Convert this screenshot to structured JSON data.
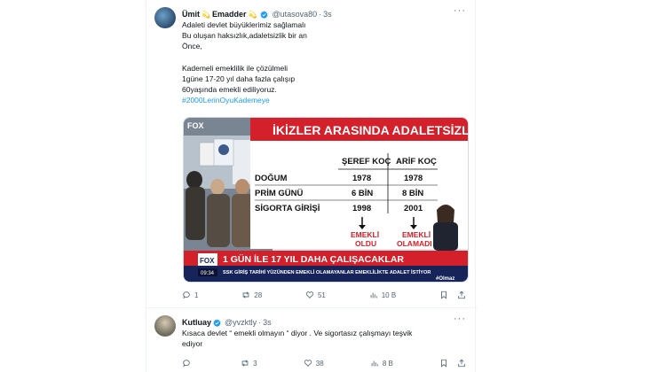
{
  "tweet1": {
    "name": "Ümit",
    "emoji_1": "💫",
    "name_2": "Emadder",
    "emoji_2": "💫",
    "handle": "@utasova80",
    "dot": "·",
    "time": "3s",
    "lines": [
      "Adaleti devlet büyüklerimiz sağlamalı",
      "Bu oluşan haksızlık,adaletsizlik bir an",
      "Önce,",
      "",
      "Kademeli emeklilik ile çözülmeli",
      "1güne 17-20 yıl daha fazla çalışıp",
      "60yaşında emekli ediliyoruz."
    ],
    "hashtag": "#2000LerinOyuKademeye",
    "media": {
      "channel_logo": "FOX",
      "headline": "İKİZLER ARASINDA ADALETSİZLİK",
      "col_1": "ŞEREF KOÇ",
      "col_2": "ARİF KOÇ",
      "rows": [
        {
          "label": "DOĞUM",
          "v1": "1978",
          "v2": "1978"
        },
        {
          "label": "PRİM GÜNÜ",
          "v1": "6 BİN",
          "v2": "8 BİN"
        },
        {
          "label": "SİGORTA GİRİŞİ",
          "v1": "1998",
          "v2": "2001"
        }
      ],
      "result_1a": "EMEKLİ",
      "result_1b": "OLDU",
      "result_2a": "EMEKLİ",
      "result_2b": "OLAMADI",
      "banner": "1 GÜN İLE 17 YIL DAHA ÇALIŞACAKLAR",
      "subbanner": "SSK GİRİŞ TARİHİ YÜZÜNDEN EMEKLİ OLAMAYANLAR EMEKLİLİKTE ADALET İSTİYOR",
      "clock": "09:34",
      "tag": "#Olmaz"
    },
    "actions": {
      "reply": "1",
      "retweet": "28",
      "like": "51",
      "views": "10 B"
    }
  },
  "tweet2": {
    "name": "Kutluay",
    "handle": "@yvzktly",
    "dot": "·",
    "time": "3s",
    "lines": [
      "Kısaca devlet “ emekli olmayın “ diyor . Ve sigortasız çalışmayı teşvik",
      "ediyor"
    ],
    "actions": {
      "reply": "",
      "retweet": "3",
      "like": "38",
      "views": "8 B"
    }
  },
  "colors": {
    "accent": "#1d9bf0",
    "tv_red": "#d4202a",
    "tv_navy": "#16245a"
  },
  "icons": [
    "more-icon",
    "verified-icon",
    "reply-icon",
    "retweet-icon",
    "like-icon",
    "views-icon",
    "bookmark-icon",
    "share-icon"
  ]
}
